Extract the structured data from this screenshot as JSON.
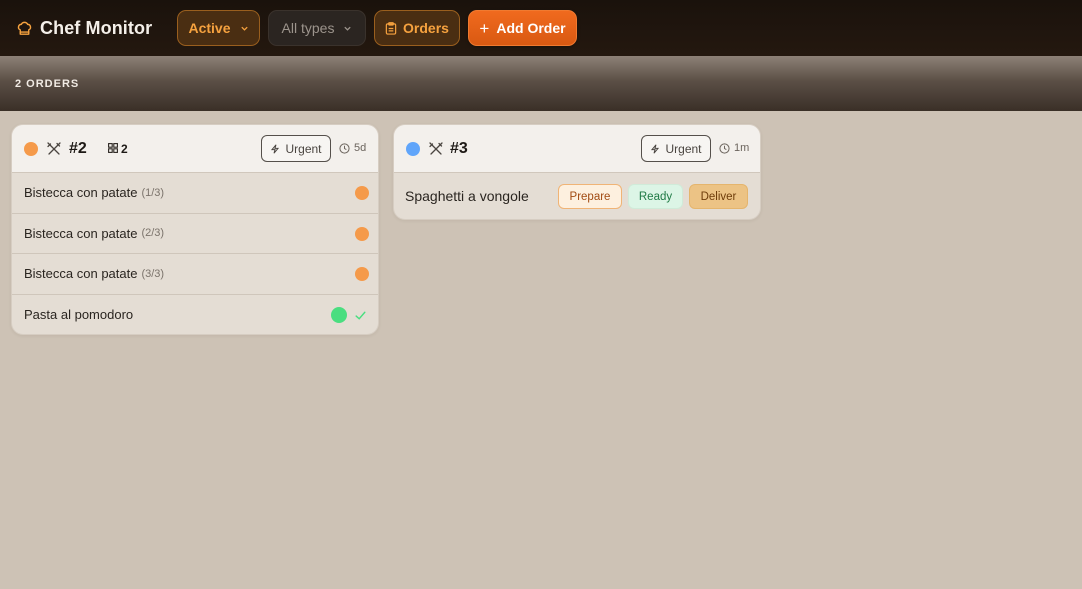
{
  "app": {
    "title": "Chef Monitor",
    "logo_icon": "chef-hat-icon"
  },
  "toolbar": {
    "status_filter": "Active",
    "type_filter": "All types",
    "orders_label": "Orders",
    "add_label": "Add Order"
  },
  "summary": {
    "count_label": "2 ORDERS"
  },
  "colors": {
    "accent": "#f6a23f",
    "primary_button": "#e8621a",
    "status_pending": "#f59a4a",
    "status_done": "#4ade80",
    "order_3_marker": "#60a5fa"
  },
  "orders": [
    {
      "number": "#2",
      "item_count": "2",
      "urgent_label": "Urgent",
      "age": "5d",
      "marker_color": "#f59a4a",
      "items": [
        {
          "name": "Bistecca con patate",
          "portion": "(1/3)",
          "status": "pending"
        },
        {
          "name": "Bistecca con patate",
          "portion": "(2/3)",
          "status": "pending"
        },
        {
          "name": "Bistecca con patate",
          "portion": "(3/3)",
          "status": "pending"
        },
        {
          "name": "Pasta al pomodoro",
          "portion": "",
          "status": "done"
        }
      ]
    },
    {
      "number": "#3",
      "urgent_label": "Urgent",
      "age": "1m",
      "marker_color": "#60a5fa",
      "items": [
        {
          "name": "Spaghetti a vongole",
          "actions": {
            "prepare": "Prepare",
            "ready": "Ready",
            "deliver": "Deliver"
          }
        }
      ]
    }
  ]
}
